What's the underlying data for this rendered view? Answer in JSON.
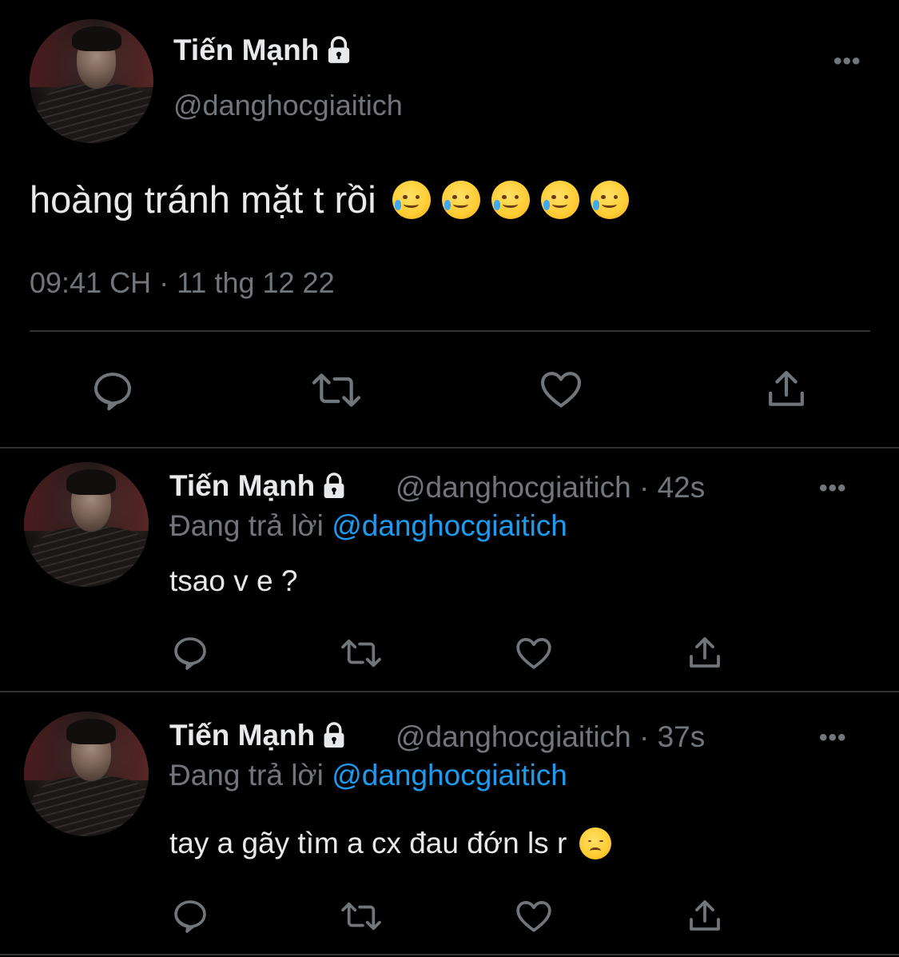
{
  "main_tweet": {
    "display_name": "Tiến Mạnh",
    "handle": "@danghocgiaitich",
    "text": "hoàng tránh mặt t rồi",
    "emoji": [
      "crying-smile",
      "crying-smile",
      "crying-smile",
      "crying-smile",
      "crying-smile"
    ],
    "timestamp": "09:41 CH · 11 thg 12 22",
    "more_label": "•••"
  },
  "replies": [
    {
      "display_name": "Tiến Mạnh",
      "handle": "@danghocgiaitich",
      "separator": "·",
      "time": "42s",
      "replying_prefix": "Đang trả lời",
      "replying_to": "@danghocgiaitich",
      "text": "tsao v e ?",
      "more_label": "•••"
    },
    {
      "display_name": "Tiến Mạnh",
      "handle": "@danghocgiaitich",
      "separator": "·",
      "time": "37s",
      "replying_prefix": "Đang trả lời",
      "replying_to": "@danghocgiaitich",
      "text": "tay a gãy tìm a cx đau đớn ls r",
      "emoji": "disappointed-face",
      "more_label": "•••"
    }
  ],
  "icons": {
    "reply": "reply-icon",
    "retweet": "retweet-icon",
    "like": "heart-icon",
    "share": "share-icon",
    "protected": "lock-icon"
  },
  "colors": {
    "background": "#000000",
    "primary_text": "#e7e9ea",
    "secondary_text": "#71767b",
    "mention": "#1d9bf0",
    "divider": "#2f3336"
  }
}
